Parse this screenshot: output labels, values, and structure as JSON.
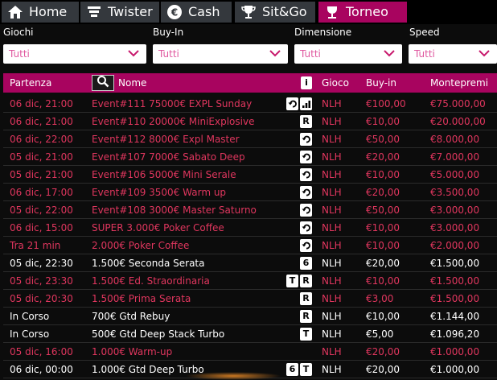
{
  "tabs": [
    {
      "label": "Home",
      "icon": "home-icon",
      "active": false
    },
    {
      "label": "Twister",
      "icon": "twister-icon",
      "active": false
    },
    {
      "label": "Cash",
      "icon": "euro-coin-icon",
      "active": false
    },
    {
      "label": "Sit&Go",
      "icon": "trophy-icon",
      "active": false
    },
    {
      "label": "Torneo",
      "icon": "cup-icon",
      "active": true
    }
  ],
  "filters": [
    {
      "label": "Giochi",
      "value": "Tutti"
    },
    {
      "label": "Buy-In",
      "value": "Tutti"
    },
    {
      "label": "Dimensione",
      "value": "Tutti"
    },
    {
      "label": "Speed",
      "value": "Tutti"
    }
  ],
  "table": {
    "headers": {
      "start": "Partenza",
      "name": "Nome",
      "info": "i",
      "game": "Gioco",
      "buyin": "Buy-in",
      "prize": "Montepremi"
    },
    "rows": [
      {
        "start": "06 dic, 21:00",
        "name": "Event#111 75000€ EXPL Sunday",
        "badges": [
          "rebuy",
          "level"
        ],
        "game": "NLH",
        "buyin": "€100,00",
        "prize": "€75.000,00",
        "color": "red"
      },
      {
        "start": "06 dic, 21:00",
        "name": "Event#110 20000€ MiniExplosive",
        "badges": [
          "R"
        ],
        "game": "NLH",
        "buyin": "€10,00",
        "prize": "€20.000,00",
        "color": "red"
      },
      {
        "start": "06 dic, 22:00",
        "name": "Event#112 8000€ Expl Master",
        "badges": [
          "rebuy"
        ],
        "game": "NLH",
        "buyin": "€50,00",
        "prize": "€8.000,00",
        "color": "red"
      },
      {
        "start": "05 dic, 21:00",
        "name": "Event#107 7000€ Sabato Deep",
        "badges": [
          "rebuy"
        ],
        "game": "NLH",
        "buyin": "€20,00",
        "prize": "€7.000,00",
        "color": "red"
      },
      {
        "start": "05 dic, 21:00",
        "name": "Event#106 5000€ Mini Serale",
        "badges": [
          "rebuy"
        ],
        "game": "NLH",
        "buyin": "€10,00",
        "prize": "€5.000,00",
        "color": "red"
      },
      {
        "start": "06 dic, 17:00",
        "name": "Event#109 3500€ Warm up",
        "badges": [
          "rebuy"
        ],
        "game": "NLH",
        "buyin": "€20,00",
        "prize": "€3.500,00",
        "color": "red"
      },
      {
        "start": "05 dic, 22:00",
        "name": "Event#108 3000€ Master Saturno",
        "badges": [
          "rebuy"
        ],
        "game": "NLH",
        "buyin": "€50,00",
        "prize": "€3.000,00",
        "color": "red"
      },
      {
        "start": "06 dic, 15:00",
        "name": "SUPER 3.000€ Poker Coffee",
        "badges": [
          "rebuy"
        ],
        "game": "NLH",
        "buyin": "€10,00",
        "prize": "€3.000,00",
        "color": "red"
      },
      {
        "start": "Tra 21 min",
        "name": "2.000€ Poker Coffee",
        "badges": [
          "rebuy"
        ],
        "game": "NLH",
        "buyin": "€10,00",
        "prize": "€2.000,00",
        "color": "red"
      },
      {
        "start": "05 dic, 22:30",
        "name": "1.500€ Seconda Serata",
        "badges": [
          "6"
        ],
        "game": "NLH",
        "buyin": "€20,00",
        "prize": "€1.500,00",
        "color": "white"
      },
      {
        "start": "05 dic, 23:30",
        "name": "1.500€ Ed. Straordinaria",
        "badges": [
          "T",
          "R"
        ],
        "game": "NLH",
        "buyin": "€10,00",
        "prize": "€1.500,00",
        "color": "red"
      },
      {
        "start": "05 dic, 20:30",
        "name": "1.500€ Prima Serata",
        "badges": [
          "R"
        ],
        "game": "NLH",
        "buyin": "€3,00",
        "prize": "€1.500,00",
        "color": "red"
      },
      {
        "start": "In Corso",
        "name": "700€ Gtd Rebuy",
        "badges": [
          "R"
        ],
        "game": "NLH",
        "buyin": "€10,00",
        "prize": "€1.144,00",
        "color": "white"
      },
      {
        "start": "In Corso",
        "name": "500€ Gtd Deep Stack Turbo",
        "badges": [
          "T"
        ],
        "game": "NLH",
        "buyin": "€5,00",
        "prize": "€1.096,20",
        "color": "white"
      },
      {
        "start": "05 dic, 16:00",
        "name": "1.000€ Warm-up",
        "badges": [],
        "game": "NLH",
        "buyin": "€20,00",
        "prize": "€1.000,00",
        "color": "red"
      },
      {
        "start": "06 dic, 00:00",
        "name": "1.000€ Gtd Deep Turbo",
        "badges": [
          "6",
          "T"
        ],
        "game": "NLH",
        "buyin": "€20,00",
        "prize": "€1.000,00",
        "color": "white"
      }
    ]
  },
  "colors": {
    "accent": "#a8045f",
    "red_text": "#e0365e",
    "tab_bg": "#34383d"
  }
}
